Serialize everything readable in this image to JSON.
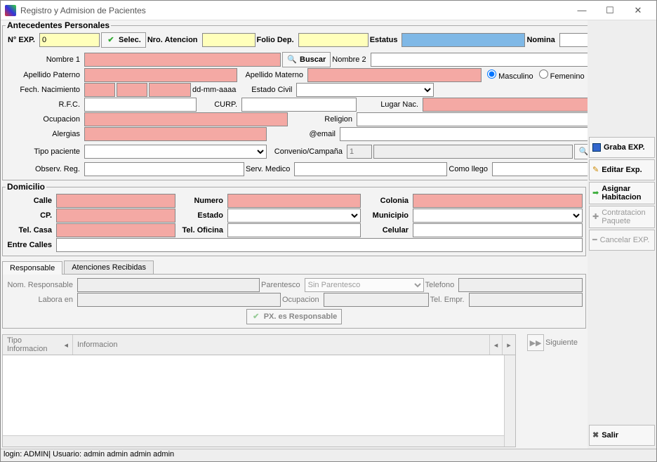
{
  "window": {
    "title": "Registro y Admision de Pacientes"
  },
  "antecedentes": {
    "legend": "Antecedentes Personales",
    "no_exp_label": "N° EXP.",
    "no_exp_value": "0",
    "selec_label": "Selec.",
    "nro_atencion_label": "Nro. Atencion",
    "nro_atencion_value": "",
    "folio_dep_label": "Folio Dep.",
    "folio_dep_value": "",
    "estatus_label": "Estatus",
    "estatus_value": "",
    "nomina_label": "Nomina",
    "nomina_value": "",
    "nombre1_label": "Nombre 1",
    "nombre1_value": "",
    "buscar_label": "Buscar",
    "nombre2_label": "Nombre 2",
    "nombre2_value": "",
    "apellido_paterno_label": "Apellido Paterno",
    "apellido_paterno_value": "",
    "apellido_materno_label": "Apellido Materno",
    "apellido_materno_value": "",
    "masculino_label": "Masculino",
    "femenino_label": "Femenino",
    "fech_nacimiento_label": "Fech. Nacimiento",
    "fech_nac_d": "",
    "fech_nac_m": "",
    "fech_nac_a": "",
    "fech_nac_hint": "dd-mm-aaaa",
    "estado_civil_label": "Estado Civil",
    "estado_civil_value": "",
    "rfc_label": "R.F.C.",
    "rfc_value": "",
    "curp_label": "CURP.",
    "curp_value": "",
    "lugar_nac_label": "Lugar Nac.",
    "lugar_nac_value": "",
    "ocupacion_label": "Ocupacion",
    "ocupacion_value": "",
    "religion_label": "Religion",
    "religion_value": "",
    "alergias_label": "Alergias",
    "alergias_value": "",
    "email_label": "@email",
    "email_value": "",
    "tipo_paciente_label": "Tipo paciente",
    "tipo_paciente_value": "",
    "convenio_label": "Convenio/Campaña",
    "convenio_num": "1",
    "convenio_value": "",
    "buscar2_label": "Buscar",
    "observ_reg_label": "Observ. Reg.",
    "observ_reg_value": "",
    "serv_medico_label": "Serv. Medico",
    "serv_medico_value": "",
    "como_llego_label": "Como llego",
    "como_llego_value": ""
  },
  "domicilio": {
    "legend": "Domicilio",
    "calle_label": "Calle",
    "calle_value": "",
    "numero_label": "Numero",
    "numero_value": "",
    "colonia_label": "Colonia",
    "colonia_value": "",
    "cp_label": "CP.",
    "cp_value": "",
    "estado_label": "Estado",
    "estado_value": "",
    "municipio_label": "Municipio",
    "municipio_value": "",
    "tel_casa_label": "Tel. Casa",
    "tel_casa_value": "",
    "tel_oficina_label": "Tel. Oficina",
    "tel_oficina_value": "",
    "celular_label": "Celular",
    "celular_value": "",
    "entre_calles_label": "Entre Calles",
    "entre_calles_value": ""
  },
  "tabs": {
    "responsable": "Responsable",
    "atenciones": "Atenciones Recibidas"
  },
  "responsable": {
    "nom_label": "Nom. Responsable",
    "nom_value": "",
    "parentesco_label": "Parentesco",
    "parentesco_value": "Sin Parentesco",
    "telefono_label": "Telefono",
    "telefono_value": "",
    "labora_label": "Labora en",
    "labora_value": "",
    "ocupacion_label": "Ocupacion",
    "ocupacion_value": "",
    "tel_empr_label": "Tel. Empr.",
    "tel_empr_value": "",
    "px_responsable_label": "PX. es Responsable"
  },
  "grid": {
    "col1": "Tipo Informacion",
    "col2": "Informacion",
    "siguiente": "Siguiente"
  },
  "sidebar": {
    "graba": "Graba EXP.",
    "editar": "Editar Exp.",
    "asignar": "Asignar Habitacion",
    "contratacion": "Contratacion Paquete",
    "cancelar": "Cancelar EXP.",
    "salir": "Salir"
  },
  "status": "login: ADMIN| Usuario: admin admin admin admin"
}
